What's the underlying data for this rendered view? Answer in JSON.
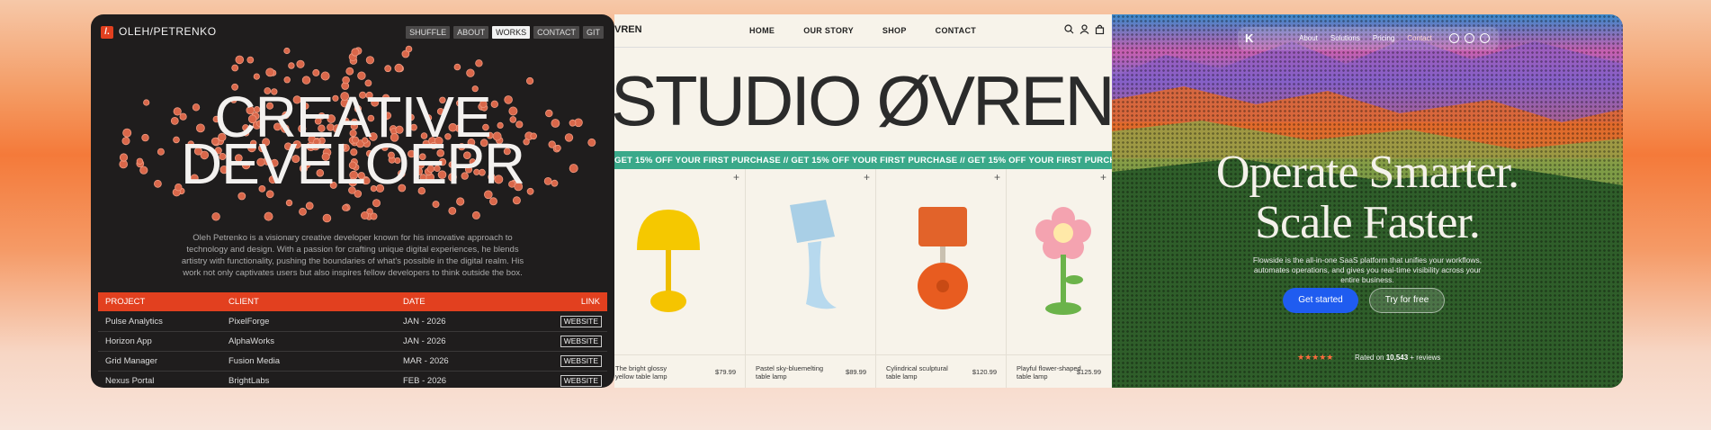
{
  "card1": {
    "logo_glyph": "/.",
    "brand": "OLEH/PETRENKO",
    "nav": [
      "SHUFFLE",
      "ABOUT",
      "WORKS",
      "CONTACT",
      "GIT"
    ],
    "active_nav": "WORKS",
    "headline_line1": "CREATIVE",
    "headline_line2": "DEVELOEPR",
    "bio": "Oleh Petrenko is a visionary creative developer known for his innovative approach to technology and design. With a passion for crafting unique digital experiences, he blends artistry with functionality, pushing the boundaries of what's possible in the digital realm. His work not only captivates users but also inspires fellow developers to think outside the box.",
    "table": {
      "headers": [
        "PROJECT",
        "CLIENT",
        "DATE",
        "LINK"
      ],
      "rows": [
        {
          "project": "Pulse Analytics",
          "client": "PixelForge",
          "date": "JAN - 2026",
          "link": "WEBSITE"
        },
        {
          "project": "Horizon App",
          "client": "AlphaWorks",
          "date": "JAN - 2026",
          "link": "WEBSITE"
        },
        {
          "project": "Grid Manager",
          "client": "Fusion Media",
          "date": "MAR - 2026",
          "link": "WEBSITE"
        },
        {
          "project": "Nexus Portal",
          "client": "BrightLabs",
          "date": "FEB - 2026",
          "link": "WEBSITE"
        }
      ]
    },
    "accent_color": "#e2401f"
  },
  "card2": {
    "brand": "VREN",
    "nav": [
      "HOME",
      "OUR STORY",
      "SHOP",
      "CONTACT"
    ],
    "headline": "STUDIO ØVREN",
    "ticker": "GET 15% OFF YOUR FIRST PURCHASE  //  GET 15% OFF YOUR FIRST PURCHASE  //  GET 15% OFF YOUR FIRST PURCHASE  //  GET 15% OFF YOUR FIRST PURCHASE  //  GET 15% OFF YOUR FIRST PURCHASE",
    "ticker_color": "#3aa98a",
    "products": [
      {
        "name": "The bright glossy yellow table lamp",
        "price": "$79.99"
      },
      {
        "name": "Pastel sky-bluemelting table lamp",
        "price": "$89.99"
      },
      {
        "name": "Cylindrical sculptural table lamp",
        "price": "$120.99"
      },
      {
        "name": "Playful flower-shaped table lamp",
        "price": "$125.99"
      }
    ]
  },
  "card3": {
    "nav": [
      "About",
      "Solutions",
      "Pricing",
      "Contact"
    ],
    "active_nav": "Contact",
    "headline_line1": "Operate Smarter.",
    "headline_line2": "Scale Faster.",
    "subtitle": "Flowside is the all-in-one SaaS platform that unifies your workflows, automates operations, and gives you real-time visibility across your entire business.",
    "primary_button": "Get started",
    "secondary_button": "Try for free",
    "stars": "★★★★★",
    "rating_prefix": "Rated on",
    "rating_count": "10,543",
    "rating_suffix": "+ reviews",
    "primary_color": "#1f5cf0"
  }
}
